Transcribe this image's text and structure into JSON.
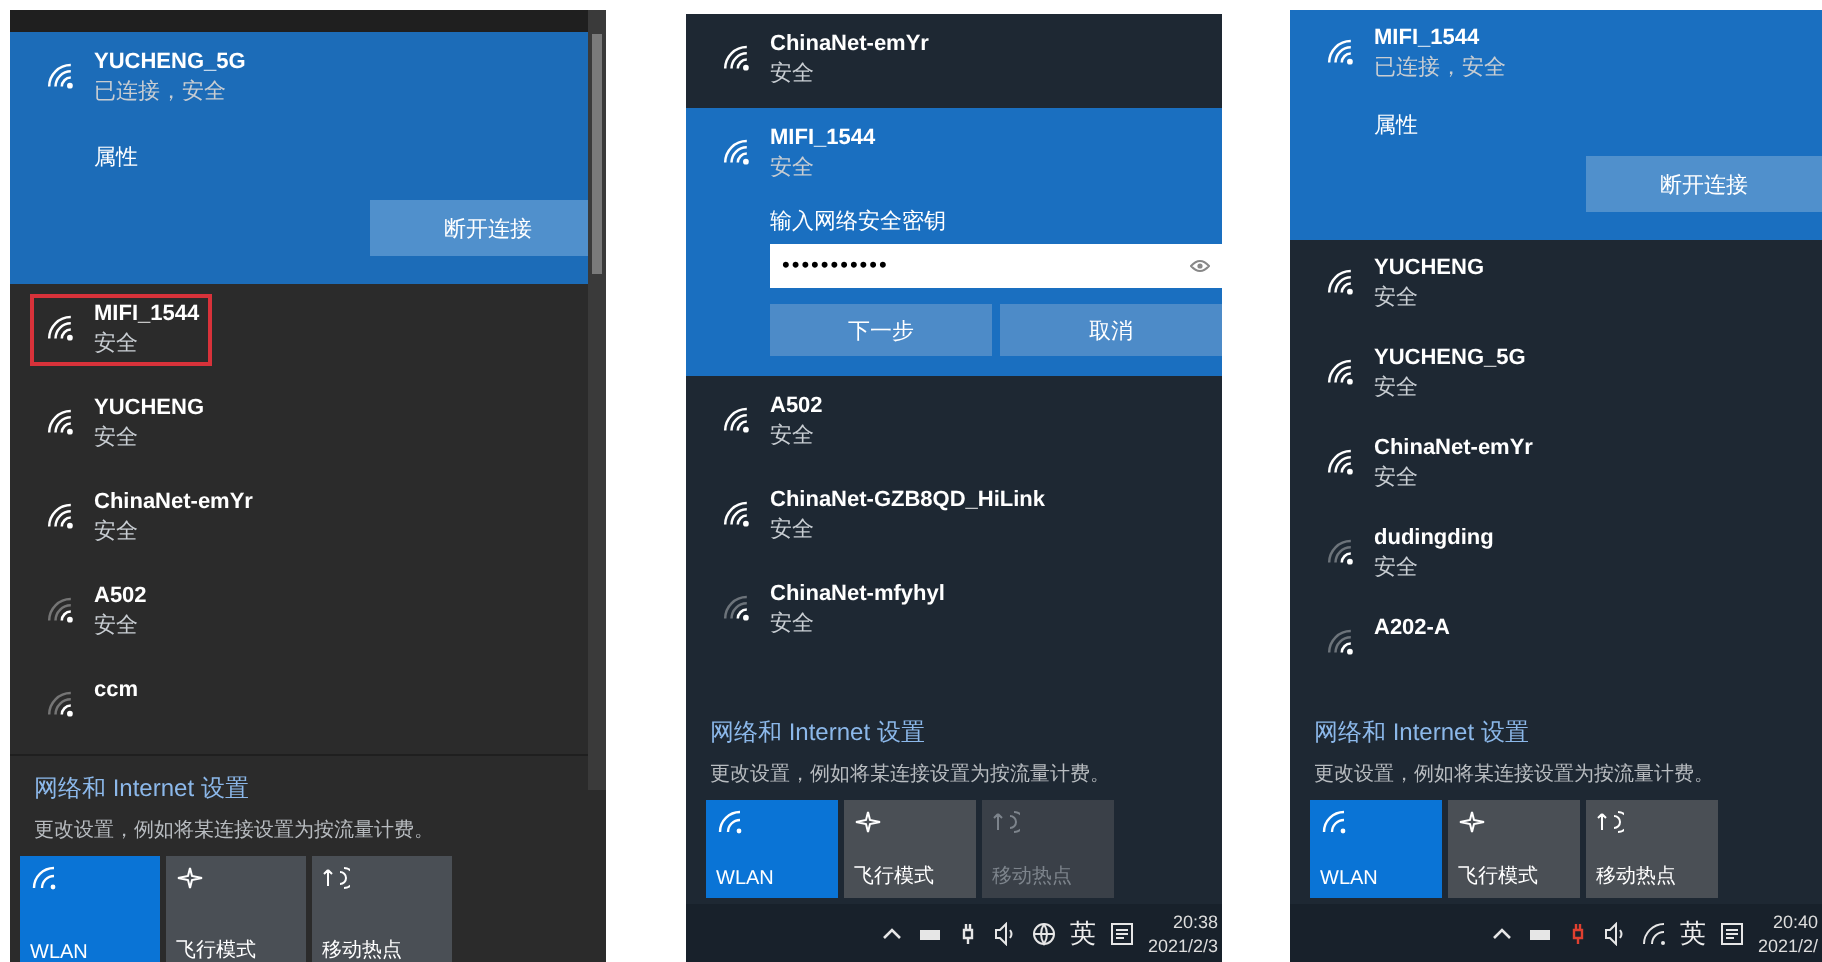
{
  "panels": [
    {
      "networks": [
        {
          "kind": "connected",
          "name": "YUCHENG_5G",
          "status": "已连接，安全",
          "properties": "属性",
          "action": "断开连接",
          "highlighted": false
        },
        {
          "kind": "plain",
          "name": "MIFI_1544",
          "status": "安全",
          "highlighted": true
        },
        {
          "kind": "plain",
          "name": "YUCHENG",
          "status": "安全",
          "highlighted": false
        },
        {
          "kind": "plain",
          "name": "ChinaNet-emYr",
          "status": "安全",
          "highlighted": false
        },
        {
          "kind": "plain",
          "name": "A502",
          "status": "安全",
          "highlighted": false
        },
        {
          "kind": "plain",
          "name": "ccm",
          "highlighted": false
        }
      ],
      "settings_link": "网络和 Internet 设置",
      "settings_hint": "更改设置，例如将某连接设置为按流量计费。",
      "tiles": [
        {
          "label": "WLAN",
          "on": true,
          "disabled": false
        },
        {
          "label": "飞行模式",
          "on": false,
          "disabled": false
        },
        {
          "label": "移动热点",
          "on": false,
          "disabled": false
        }
      ]
    },
    {
      "networks": [
        {
          "kind": "plain",
          "name": "ChinaNet-emYr",
          "status": "安全",
          "highlighted": false
        },
        {
          "kind": "password",
          "name": "MIFI_1544",
          "status": "安全",
          "prompt": "输入网络安全密钥",
          "value": "•••••••••••",
          "next": "下一步",
          "cancel": "取消",
          "highlighted": false
        },
        {
          "kind": "plain",
          "name": "A502",
          "status": "安全",
          "highlighted": false
        },
        {
          "kind": "plain",
          "name": "ChinaNet-GZB8QD_HiLink",
          "status": "安全",
          "highlighted": false
        },
        {
          "kind": "plain",
          "name": "ChinaNet-mfyhyl",
          "status": "安全",
          "highlighted": false
        }
      ],
      "settings_link": "网络和 Internet 设置",
      "settings_hint": "更改设置，例如将某连接设置为按流量计费。",
      "tiles": [
        {
          "label": "WLAN",
          "on": true,
          "disabled": false
        },
        {
          "label": "飞行模式",
          "on": false,
          "disabled": false
        },
        {
          "label": "移动热点",
          "on": false,
          "disabled": true
        }
      ],
      "taskbar": {
        "internet": false,
        "ime": "英",
        "time": "20:38",
        "date": "2021/2/3"
      }
    },
    {
      "networks": [
        {
          "kind": "connected",
          "name": "MIFI_1544",
          "status": "已连接，安全",
          "properties": "属性",
          "action": "断开连接",
          "highlighted": false
        },
        {
          "kind": "plain",
          "name": "YUCHENG",
          "status": "安全",
          "highlighted": false
        },
        {
          "kind": "plain",
          "name": "YUCHENG_5G",
          "status": "安全",
          "highlighted": false
        },
        {
          "kind": "plain",
          "name": "ChinaNet-emYr",
          "status": "安全",
          "highlighted": false
        },
        {
          "kind": "plain",
          "name": "dudingding",
          "status": "安全",
          "highlighted": false
        },
        {
          "kind": "plain",
          "name": "A202-A",
          "highlighted": false
        }
      ],
      "settings_link": "网络和 Internet 设置",
      "settings_hint": "更改设置，例如将某连接设置为按流量计费。",
      "tiles": [
        {
          "label": "WLAN",
          "on": true,
          "disabled": false
        },
        {
          "label": "飞行模式",
          "on": false,
          "disabled": false
        },
        {
          "label": "移动热点",
          "on": false,
          "disabled": false
        }
      ],
      "taskbar": {
        "internet": true,
        "ime": "英",
        "time": "20:40",
        "date": "2021/2/"
      }
    }
  ]
}
